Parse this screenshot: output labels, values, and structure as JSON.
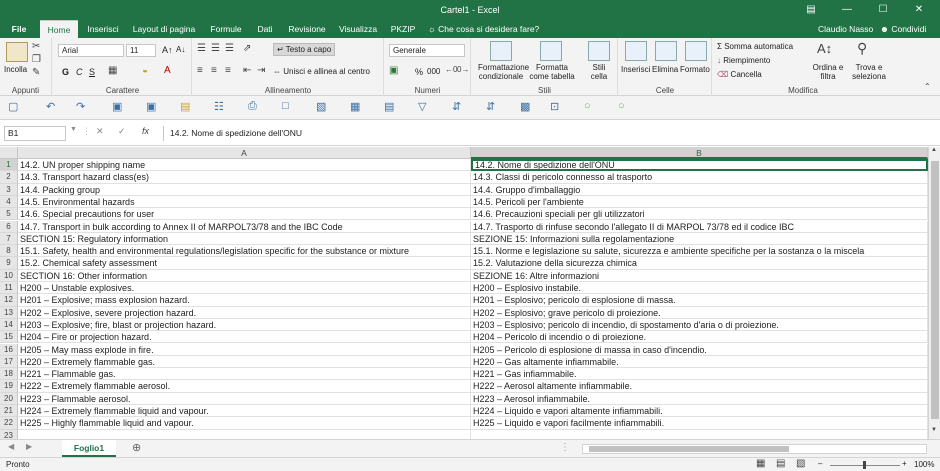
{
  "window": {
    "title": "Cartel1 - Excel",
    "user": "Claudio Nasso",
    "share_label": "Condividi"
  },
  "tabs": [
    "File",
    "Home",
    "Inserisci",
    "Layout di pagina",
    "Formule",
    "Dati",
    "Revisione",
    "Visualizza",
    "PKZIP"
  ],
  "active_tab": "Home",
  "tellme": "Che cosa si desidera fare?",
  "ribbon": {
    "clipboard": {
      "paste": "Incolla",
      "label": "Appunti"
    },
    "font": {
      "name": "Arial",
      "size": "11",
      "label": "Carattere",
      "bold": "G",
      "italic": "C",
      "underline": "S"
    },
    "alignment": {
      "wrap": "Testo a capo",
      "merge": "Unisci e allinea al centro",
      "label": "Allineamento"
    },
    "number": {
      "format": "Generale",
      "percent": "%",
      "thousands": "000",
      "label": "Numeri"
    },
    "styles": {
      "conditional": "Formattazione condizionale",
      "table": "Formatta come tabella",
      "cell": "Stili cella",
      "label": "Stili"
    },
    "cells": {
      "insert": "Inserisci",
      "delete": "Elimina",
      "format": "Formato",
      "label": "Celle"
    },
    "editing": {
      "autosum": "Somma automatica",
      "fill": "Riempimento",
      "clear": "Cancella",
      "sort": "Ordina e filtra",
      "find": "Trova e seleziona",
      "label": "Modifica"
    }
  },
  "formula_bar": {
    "cell_ref": "B1",
    "fx": "fx",
    "content": "14.2. Nome di spedizione dell'ONU"
  },
  "columns": [
    "A",
    "B"
  ],
  "selected_column": "B",
  "selected_row": "1",
  "rows": [
    {
      "n": "1",
      "a": "14.2. UN proper shipping name",
      "b": "14.2. Nome di spedizione dell'ONU"
    },
    {
      "n": "2",
      "a": "14.3. Transport hazard class(es)",
      "b": "14.3. Classi di pericolo connesso al trasporto"
    },
    {
      "n": "3",
      "a": "14.4. Packing group",
      "b": "14.4. Gruppo d'imballaggio"
    },
    {
      "n": "4",
      "a": "14.5. Environmental hazards",
      "b": "14.5. Pericoli per l'ambiente"
    },
    {
      "n": "5",
      "a": "14.6. Special precautions for user",
      "b": "14.6. Precauzioni speciali per gli utilizzatori"
    },
    {
      "n": "6",
      "a": "14.7. Transport in bulk according to Annex II of MARPOL73/78 and the IBC Code",
      "b": "14.7. Trasporto di rinfuse secondo l'allegato II di MARPOL 73/78 ed il codice IBC"
    },
    {
      "n": "7",
      "a": "SECTION 15: Regulatory information",
      "b": "SEZIONE 15: Informazioni sulla regolamentazione"
    },
    {
      "n": "8",
      "a": "15.1. Safety, health and environmental regulations/legislation specific for the substance or mixture",
      "b": "15.1. Norme e legislazione su salute, sicurezza e ambiente specifiche per la sostanza o la miscela"
    },
    {
      "n": "9",
      "a": "15.2. Chemical safety assessment",
      "b": "15.2. Valutazione della sicurezza chimica"
    },
    {
      "n": "10",
      "a": "SECTION 16: Other information",
      "b": "SEZIONE 16: Altre informazioni"
    },
    {
      "n": "11",
      "a": "H200 – Unstable explosives.",
      "b": "H200 – Esplosivo instabile."
    },
    {
      "n": "12",
      "a": "H201 – Explosive; mass explosion hazard.",
      "b": "H201 – Esplosivo; pericolo di esplosione di massa."
    },
    {
      "n": "13",
      "a": "H202 – Explosive, severe projection hazard.",
      "b": "H202 – Esplosivo; grave pericolo di proiezione."
    },
    {
      "n": "14",
      "a": "H203 – Explosive; fire, blast or projection hazard.",
      "b": "H203 – Esplosivo; pericolo di incendio, di spostamento d'aria o di proiezione."
    },
    {
      "n": "15",
      "a": "H204 – Fire or projection hazard.",
      "b": "H204 – Pericolo di incendio o di proiezione."
    },
    {
      "n": "16",
      "a": "H205 – May mass explode in fire.",
      "b": "H205 – Pericolo di esplosione di massa in caso d'incendio."
    },
    {
      "n": "17",
      "a": "H220 – Extremely flammable gas.",
      "b": "H220 – Gas altamente infiammabile."
    },
    {
      "n": "18",
      "a": "H221 – Flammable gas.",
      "b": "H221 – Gas infiammabile."
    },
    {
      "n": "19",
      "a": "H222 – Extremely flammable aerosol.",
      "b": "H222 – Aerosol altamente infiammabile."
    },
    {
      "n": "20",
      "a": "H223 – Flammable aerosol.",
      "b": "H223 – Aerosol infiammabile."
    },
    {
      "n": "21",
      "a": "H224 – Extremely flammable liquid and vapour.",
      "b": "H224 – Liquido e vapori altamente infiammabili."
    },
    {
      "n": "22",
      "a": "H225 – Highly flammable liquid and vapour.",
      "b": "H225 – Liquido e vapori facilmente infiammabili."
    },
    {
      "n": "23",
      "a": "",
      "b": ""
    }
  ],
  "sheet": {
    "name": "Foglio1"
  },
  "status": {
    "text": "Pronto",
    "zoom": "100%"
  },
  "colors": {
    "accent": "#217346"
  }
}
